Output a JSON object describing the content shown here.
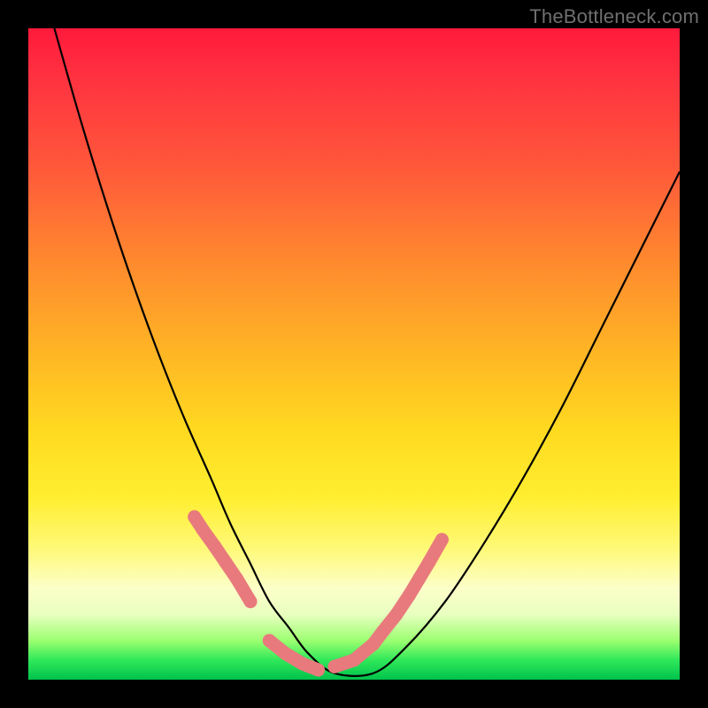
{
  "watermark": "TheBottleneck.com",
  "chart_data": {
    "type": "line",
    "title": "",
    "xlabel": "",
    "ylabel": "",
    "x_range": [
      0,
      1
    ],
    "y_range": [
      0,
      1
    ],
    "series": [
      {
        "name": "curve",
        "stroke": "#000000",
        "x": [
          0.04,
          0.08,
          0.12,
          0.16,
          0.2,
          0.24,
          0.28,
          0.31,
          0.34,
          0.37,
          0.4,
          0.43,
          0.47,
          0.53,
          0.58,
          0.64,
          0.7,
          0.76,
          0.82,
          0.88,
          0.94,
          1.0
        ],
        "y": [
          1.0,
          0.86,
          0.73,
          0.61,
          0.5,
          0.4,
          0.31,
          0.24,
          0.18,
          0.12,
          0.08,
          0.04,
          0.01,
          0.01,
          0.05,
          0.12,
          0.21,
          0.31,
          0.42,
          0.54,
          0.66,
          0.78
        ]
      }
    ],
    "overlay_points": {
      "name": "pink-markers",
      "color": "#e87a7d",
      "sections": [
        {
          "side": "left",
          "x": [
            0.255,
            0.268,
            0.286,
            0.303,
            0.32,
            0.341
          ],
          "y": [
            0.25,
            0.23,
            0.205,
            0.18,
            0.155,
            0.12
          ]
        },
        {
          "side": "right",
          "x": [
            0.47,
            0.5,
            0.53,
            0.545,
            0.565,
            0.585,
            0.6,
            0.615,
            0.635
          ],
          "y": [
            0.02,
            0.03,
            0.055,
            0.075,
            0.1,
            0.13,
            0.155,
            0.18,
            0.215
          ]
        },
        {
          "side": "valley",
          "x": [
            0.37,
            0.395,
            0.42,
            0.445
          ],
          "y": [
            0.06,
            0.04,
            0.025,
            0.015
          ]
        }
      ]
    },
    "colors": {
      "background_top": "#ff1a3b",
      "background_bottom": "#00c24b",
      "frame": "#000000",
      "marker": "#e87a7d"
    }
  }
}
